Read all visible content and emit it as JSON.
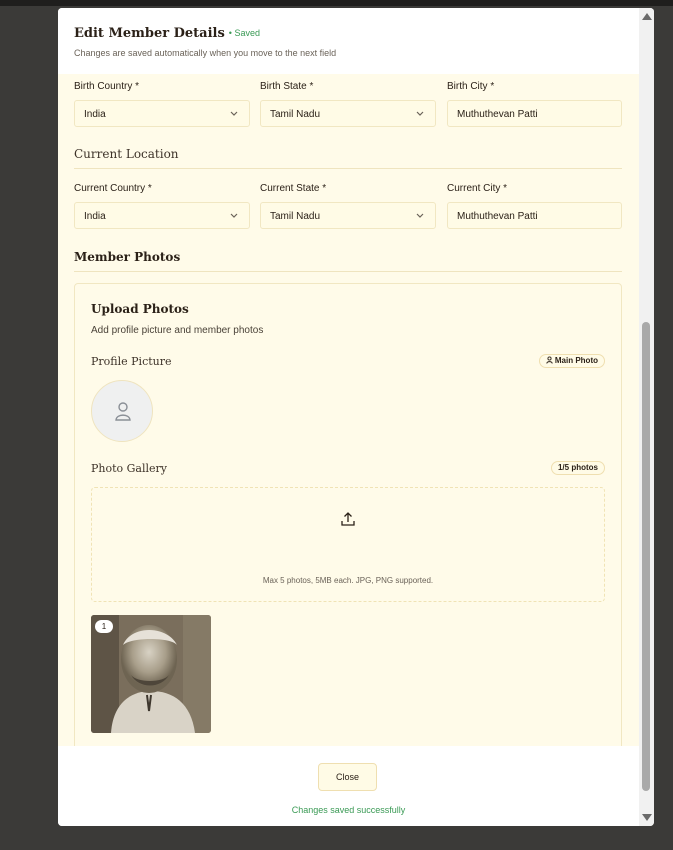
{
  "modal": {
    "title": "Edit Member Details",
    "saved_badge": "• Saved",
    "subtitle": "Changes are saved automatically when you move to the next field"
  },
  "birth": {
    "country_label": "Birth Country *",
    "country_value": "India",
    "state_label": "Birth State *",
    "state_value": "Tamil Nadu",
    "city_label": "Birth City *",
    "city_value": "Muthuthevan Patti"
  },
  "current": {
    "section_title": "Current Location",
    "country_label": "Current Country *",
    "country_value": "India",
    "state_label": "Current State *",
    "state_value": "Tamil Nadu",
    "city_label": "Current City *",
    "city_value": "Muthuthevan Patti"
  },
  "photos": {
    "section_title": "Member Photos",
    "card_title": "Upload Photos",
    "card_subtitle": "Add profile picture and member photos",
    "profile_label": "Profile Picture",
    "main_photo_badge": "Main Photo",
    "gallery_label": "Photo Gallery",
    "gallery_count": "1/5 photos",
    "upload_hint": "Max 5 photos, 5MB each. JPG, PNG supported.",
    "thumb_number": "1"
  },
  "footer": {
    "close_label": "Close",
    "status": "Changes saved successfully"
  },
  "icons": {
    "chevron": "chevron-down-icon",
    "avatar": "user-icon",
    "upload": "upload-icon",
    "badge": "user-small-icon"
  },
  "colors": {
    "accent_green": "#3a9a55",
    "panel_bg": "#fffbe9",
    "border": "#f1e7c2"
  }
}
